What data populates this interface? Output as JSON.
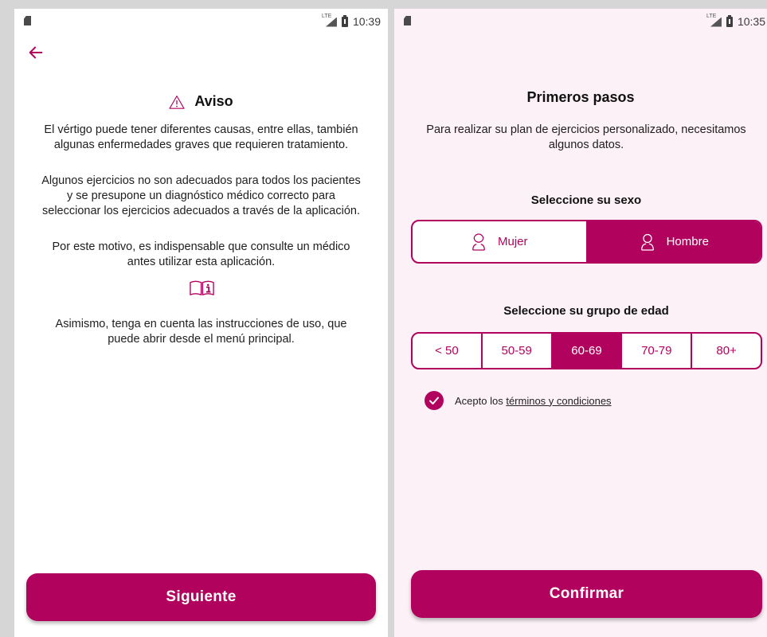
{
  "left_screen": {
    "status_bar": {
      "time": "10:39",
      "network": "LTE"
    },
    "title": "Aviso",
    "paragraphs": {
      "p1_line1": "El vértigo puede tener diferentes causas, entre ellas, también",
      "p1_line2": "algunas enfermedades graves que requieren tratamiento.",
      "p2_line1": "Algunos ejercicios no son adecuados para todos los pacientes",
      "p2_line2": "y se presupone un diagnóstico médico correcto para",
      "p2_line3": "seleccionar los ejercicios adecuados a través de la aplicación.",
      "p3_line1": "Por este motivo, es indispensable que consulte un médico",
      "p3_line2": "antes utilizar esta aplicación.",
      "p4_line1": "Asimismo, tenga en cuenta las instrucciones de uso, que",
      "p4_line2": "puede abrir desde el menú principal."
    },
    "next_button": "Siguiente"
  },
  "right_screen": {
    "status_bar": {
      "time": "10:35",
      "network": "LTE"
    },
    "title": "Primeros pasos",
    "intro_line1": "Para realizar su plan de ejercicios personalizado, necesitamos",
    "intro_line2": "algunos datos.",
    "sex_label": "Seleccione su sexo",
    "sex_options": {
      "female": "Mujer",
      "male": "Hombre"
    },
    "sex_selected": "Hombre",
    "age_label": "Seleccione su grupo de edad",
    "age_options": {
      "a0": "< 50",
      "a1": "50-59",
      "a2": "60-69",
      "a3": "70-79",
      "a4": "80+"
    },
    "age_selected": "60-69",
    "terms_prefix": "Acepto los ",
    "terms_link": "términos y condiciones",
    "terms_checked": true,
    "confirm_button": "Confirmar"
  },
  "colors": {
    "accent": "#b1035e",
    "right_background": "#fcf1f6",
    "left_background": "#ffffff"
  },
  "icons": [
    "sd-card-icon",
    "signal-icon",
    "battery-icon",
    "back-arrow-icon",
    "warning-icon",
    "info-book-icon",
    "female-person-icon",
    "male-person-icon",
    "check-icon"
  ]
}
